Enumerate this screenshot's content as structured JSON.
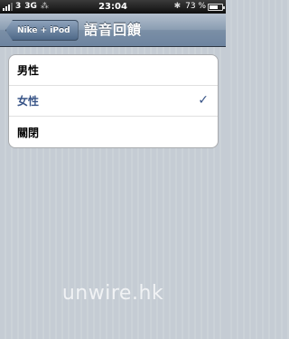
{
  "status_bar": {
    "carrier": "3",
    "network": "3G",
    "activity": "⁂",
    "time": "23:04",
    "bluetooth": "✱",
    "battery_percent": "73 %",
    "battery_level": 0.73
  },
  "nav": {
    "back_label": "Nike + iPod",
    "title": "語音回饋"
  },
  "options": [
    {
      "label": "男性",
      "selected": false
    },
    {
      "label": "女性",
      "selected": true
    },
    {
      "label": "關閉",
      "selected": false
    }
  ],
  "checkmark": "✓",
  "watermark": "unwire.hk",
  "colors": {
    "selected_text": "#385487",
    "nav_bar": "#7b8fa6",
    "background": "#c5ccd4"
  }
}
